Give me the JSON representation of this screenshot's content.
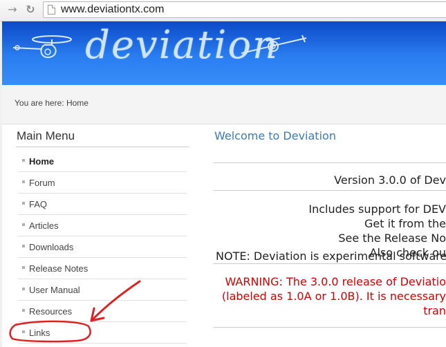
{
  "browser": {
    "url": "www.deviationtx.com",
    "back_icon": "back-arrow-icon",
    "reload_icon": "reload-icon"
  },
  "header": {
    "logo_text": "deviation"
  },
  "breadcrumb": {
    "text": "You are here: Home"
  },
  "sidebar": {
    "title": "Main Menu",
    "items": [
      {
        "label": "Home",
        "active": true
      },
      {
        "label": "Forum"
      },
      {
        "label": "FAQ"
      },
      {
        "label": "Articles"
      },
      {
        "label": "Downloads"
      },
      {
        "label": "Release Notes"
      },
      {
        "label": "User Manual"
      },
      {
        "label": "Resources"
      },
      {
        "label": "Links"
      }
    ]
  },
  "main": {
    "title": "Welcome to Deviation",
    "version_line": "Version 3.0.0 of Dev",
    "lines": [
      "Includes support for DEV",
      "Get it from the",
      "See the Release No",
      "Also check ou"
    ],
    "warning_lines": [
      "WARNING: The 3.0.0 release of Deviatio",
      "(labeled as 1.0A or 1.0B).  It is necessary",
      "tran"
    ],
    "note": "NOTE: Deviation is experimental software."
  },
  "colors": {
    "banner_top": "#0c49c8",
    "banner_bottom": "#3a8ef8",
    "title_blue": "#3d7ab3",
    "warning_red": "#d40000",
    "annotation_red": "#e02020"
  }
}
